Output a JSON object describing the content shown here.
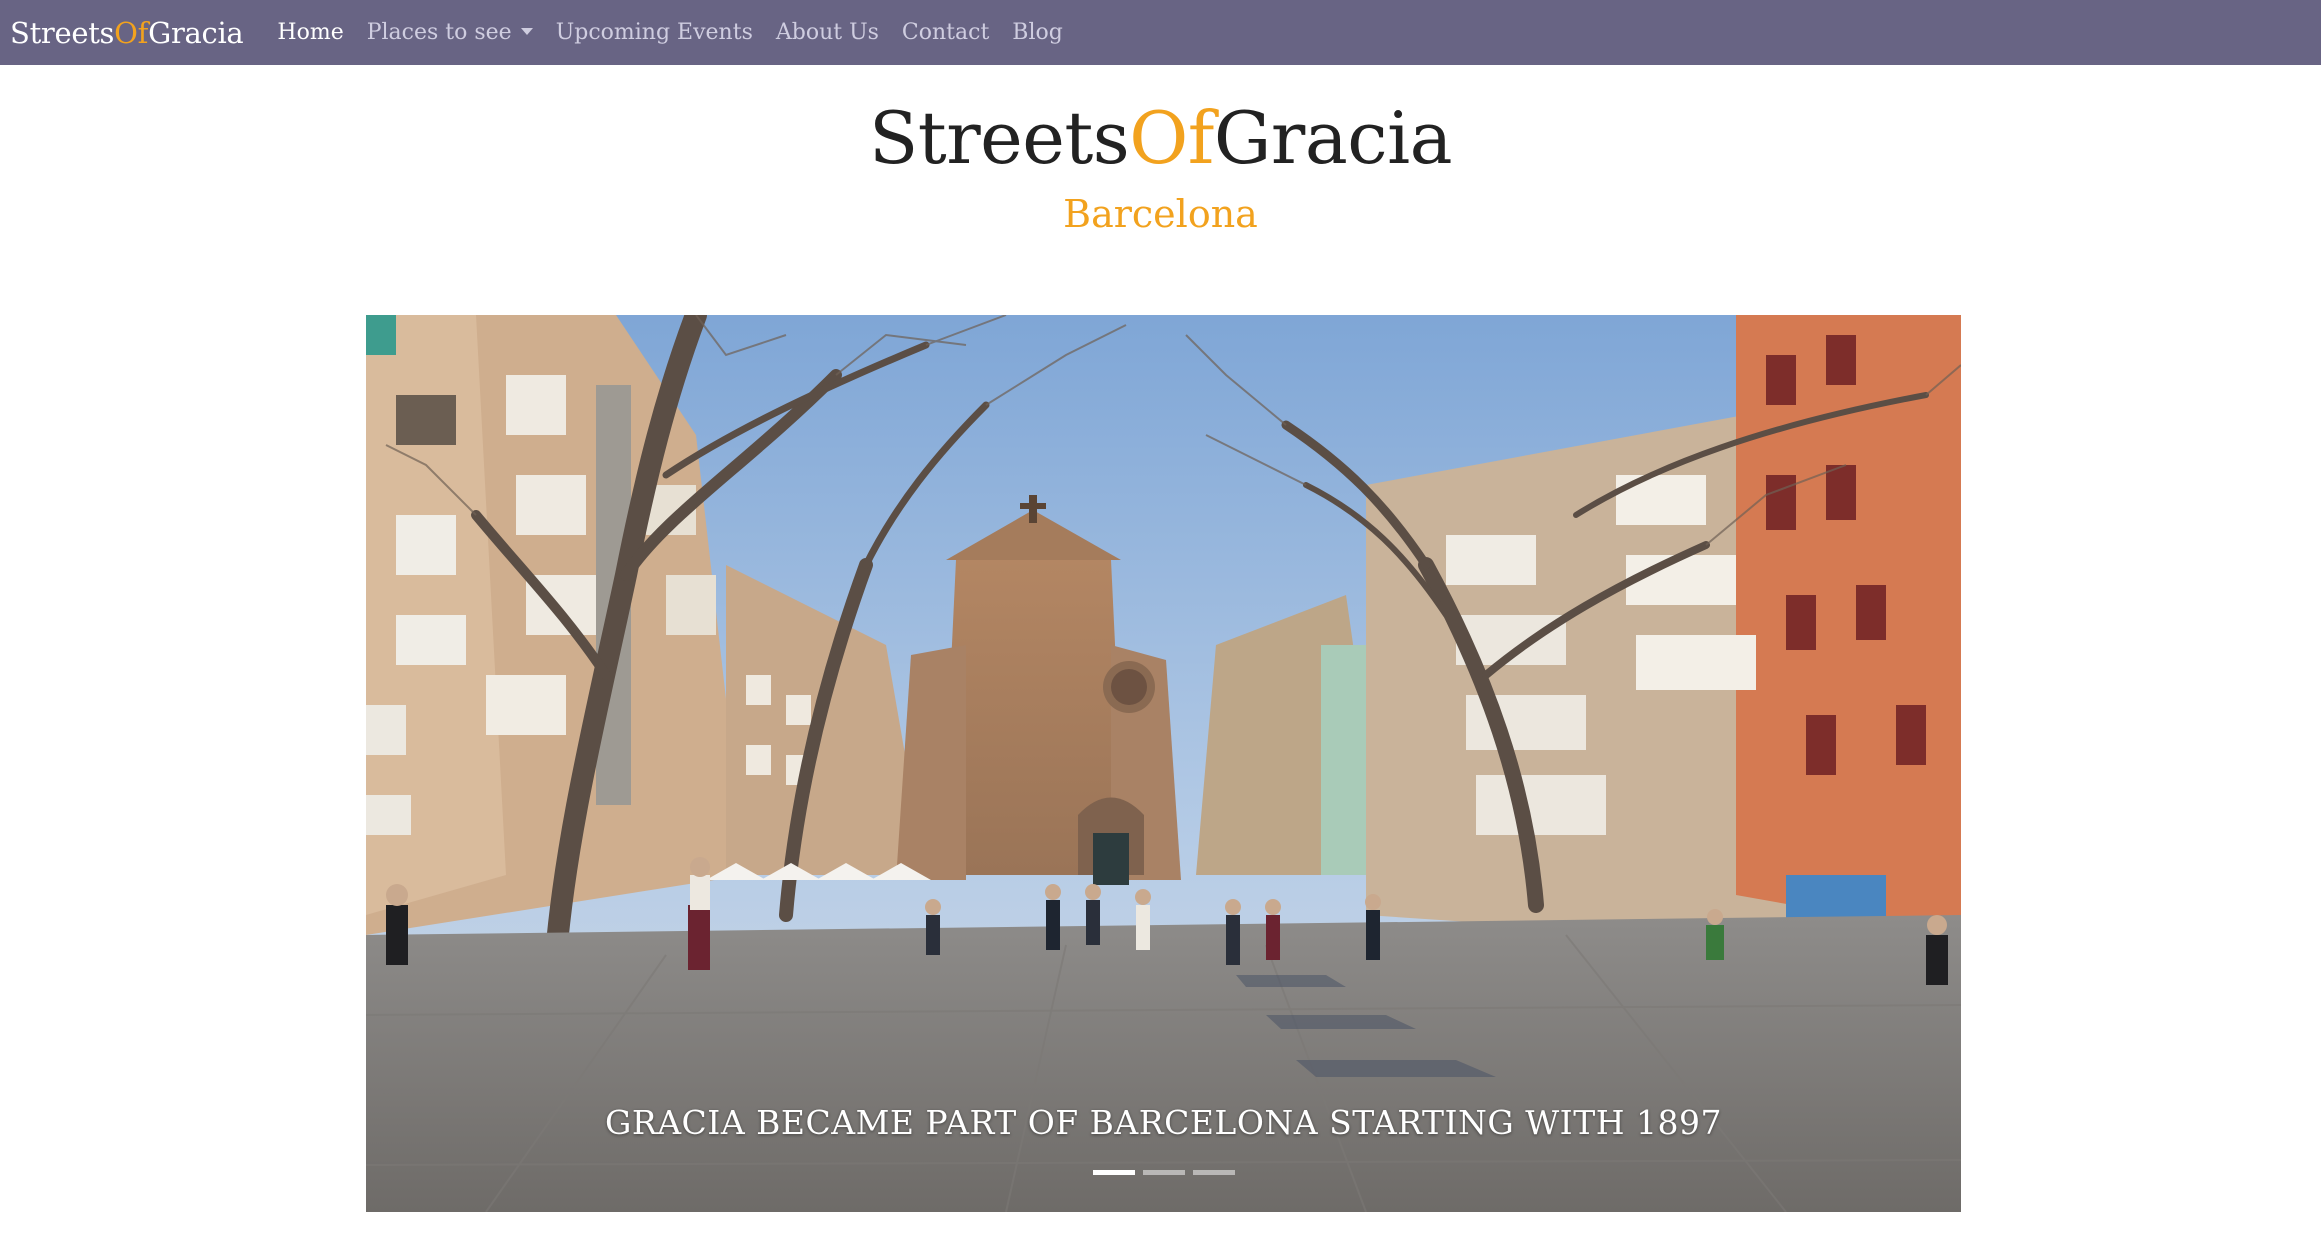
{
  "navbar": {
    "brand": {
      "part1": "Streets",
      "part2": "Of",
      "part3": "Gracia"
    },
    "links": [
      {
        "label": "Home"
      },
      {
        "label": "Places to see"
      },
      {
        "label": "Upcoming Events"
      },
      {
        "label": "About Us"
      },
      {
        "label": "Contact"
      },
      {
        "label": "Blog"
      }
    ]
  },
  "header": {
    "title": {
      "part1": "Streets",
      "part2": "Of",
      "part3": "Gracia"
    },
    "subtitle": "Barcelona"
  },
  "carousel": {
    "caption": "GRACIA BECAME PART OF BARCELONA STARTING WITH 1897",
    "slide_count": 3,
    "active_slide": 1
  },
  "colors": {
    "navbar_bg": "#686484",
    "accent": "#f2a21e",
    "title_text": "#222222"
  }
}
